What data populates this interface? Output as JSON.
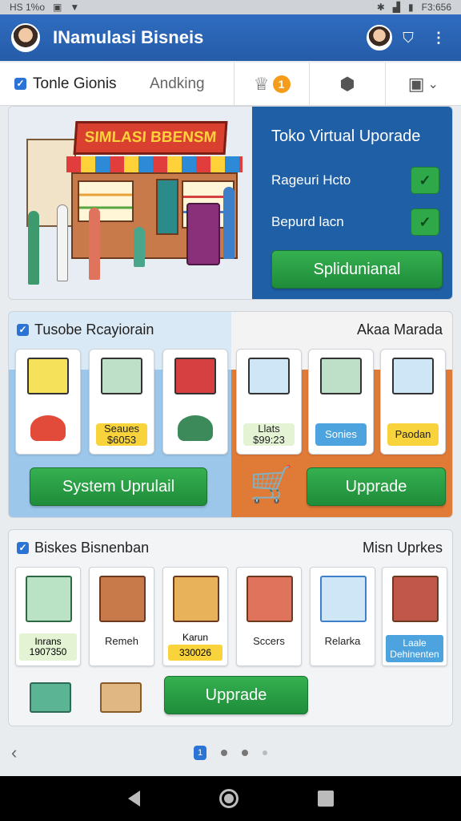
{
  "status_bar": {
    "left_text": "HS 1%o",
    "right_text": "F3:656"
  },
  "app_bar": {
    "title": "INamulasi Bisneis"
  },
  "tab_bar": {
    "main_label": "Tonle Gionis",
    "rank_label": "Andking",
    "badge_count": "1"
  },
  "hero": {
    "sign_text": "SIMLASI BBENSM",
    "panel_title": "Toko Virtual Uporade",
    "rows": [
      {
        "label": "Rageuri Hcto"
      },
      {
        "label": "Bepurd lacn"
      }
    ],
    "button_label": "Splidunianal"
  },
  "section_two": {
    "left_header": "Tusobe Rcayiorain",
    "right_header": "Akaa Marada",
    "left_cards": [
      {
        "label": "",
        "value": ""
      },
      {
        "label": "Seaues",
        "value": "$6053"
      },
      {
        "label": "",
        "value": ""
      }
    ],
    "right_cards": [
      {
        "label": "Llats",
        "value": "$99:23"
      },
      {
        "label": "Sonies",
        "value": ""
      },
      {
        "label": "Paodan",
        "value": ""
      }
    ],
    "left_button": "System Uprulail",
    "right_button": "Upprade"
  },
  "section_three": {
    "header": "Biskes Bisnenban",
    "right_label": "Misn Uprkes",
    "cards": [
      {
        "label": "Inrans",
        "value": "1907350"
      },
      {
        "label": "Remeh",
        "value": ""
      },
      {
        "label": "Karun",
        "value": "330026"
      },
      {
        "label": "Sccers",
        "value": ""
      },
      {
        "label": "Relarka",
        "value": ""
      },
      {
        "label": "Laale Dehinenten",
        "value": ""
      }
    ],
    "button_label": "Upprade"
  },
  "pager": {
    "active_page": "1"
  },
  "colors": {
    "primary": "#2f6cc0",
    "accent_green": "#2fa84a",
    "orange": "#e07a37",
    "badge": "#f59c1a"
  }
}
